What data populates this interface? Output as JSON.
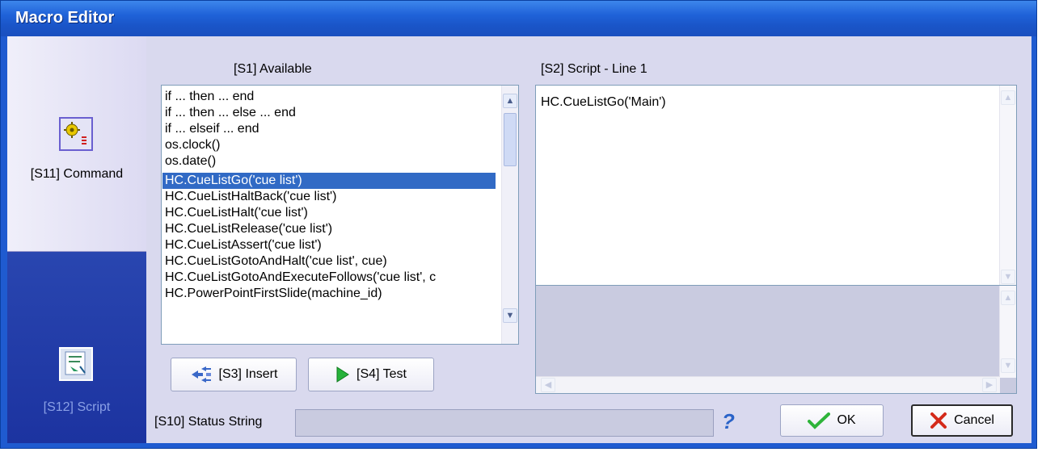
{
  "window": {
    "title": "Macro Editor"
  },
  "sidebar": {
    "command": {
      "label": "[S11] Command",
      "icon": "command-gear-icon"
    },
    "script": {
      "label": "[S12] Script",
      "icon": "script-icon"
    }
  },
  "available": {
    "header": "[S1] Available",
    "items": [
      "if ... then ... end",
      "if ... then ... else ... end",
      "if ... elseif ... end",
      "os.clock()",
      "os.date()",
      "HC.CueListGo('cue list')",
      "HC.CueListHaltBack('cue list')",
      "HC.CueListHalt('cue list')",
      "HC.CueListRelease('cue list')",
      "HC.CueListAssert('cue list')",
      "HC.CueListGotoAndHalt('cue list', cue)",
      "HC.CueListGotoAndExecuteFollows('cue list', c",
      "HC.PowerPointFirstSlide(machine_id)"
    ],
    "selected_index": 5
  },
  "script": {
    "header": "[S2] Script - Line 1",
    "text": "HC.CueListGo('Main')"
  },
  "buttons": {
    "insert": "[S3] Insert",
    "test": "[S4] Test",
    "ok": "OK",
    "cancel": "Cancel"
  },
  "status": {
    "label": "[S10] Status String",
    "value": ""
  },
  "help_glyph": "?",
  "colors": {
    "title_bar": "#1f62d8",
    "selection": "#316ac5",
    "sidebar_active": "#1c33a0"
  }
}
